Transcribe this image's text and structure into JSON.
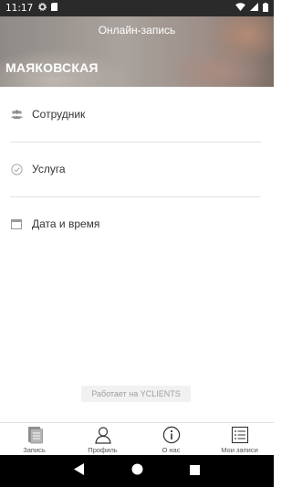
{
  "status_bar": {
    "time": "11:17"
  },
  "header": {
    "title": "Онлайн-запись",
    "location": "МАЯКОВСКАЯ"
  },
  "menu": [
    {
      "label": "Сотрудник",
      "icon": "people-icon"
    },
    {
      "label": "Услуга",
      "icon": "check-circle-icon"
    },
    {
      "label": "Дата и время",
      "icon": "calendar-icon"
    }
  ],
  "powered_by": "Работает на YCLIENTS",
  "bottom_nav": [
    {
      "label": "Запись",
      "icon": "document-icon"
    },
    {
      "label": "Профиль",
      "icon": "person-icon"
    },
    {
      "label": "О нас",
      "icon": "info-icon"
    },
    {
      "label": "Мои записи",
      "icon": "list-icon"
    }
  ]
}
